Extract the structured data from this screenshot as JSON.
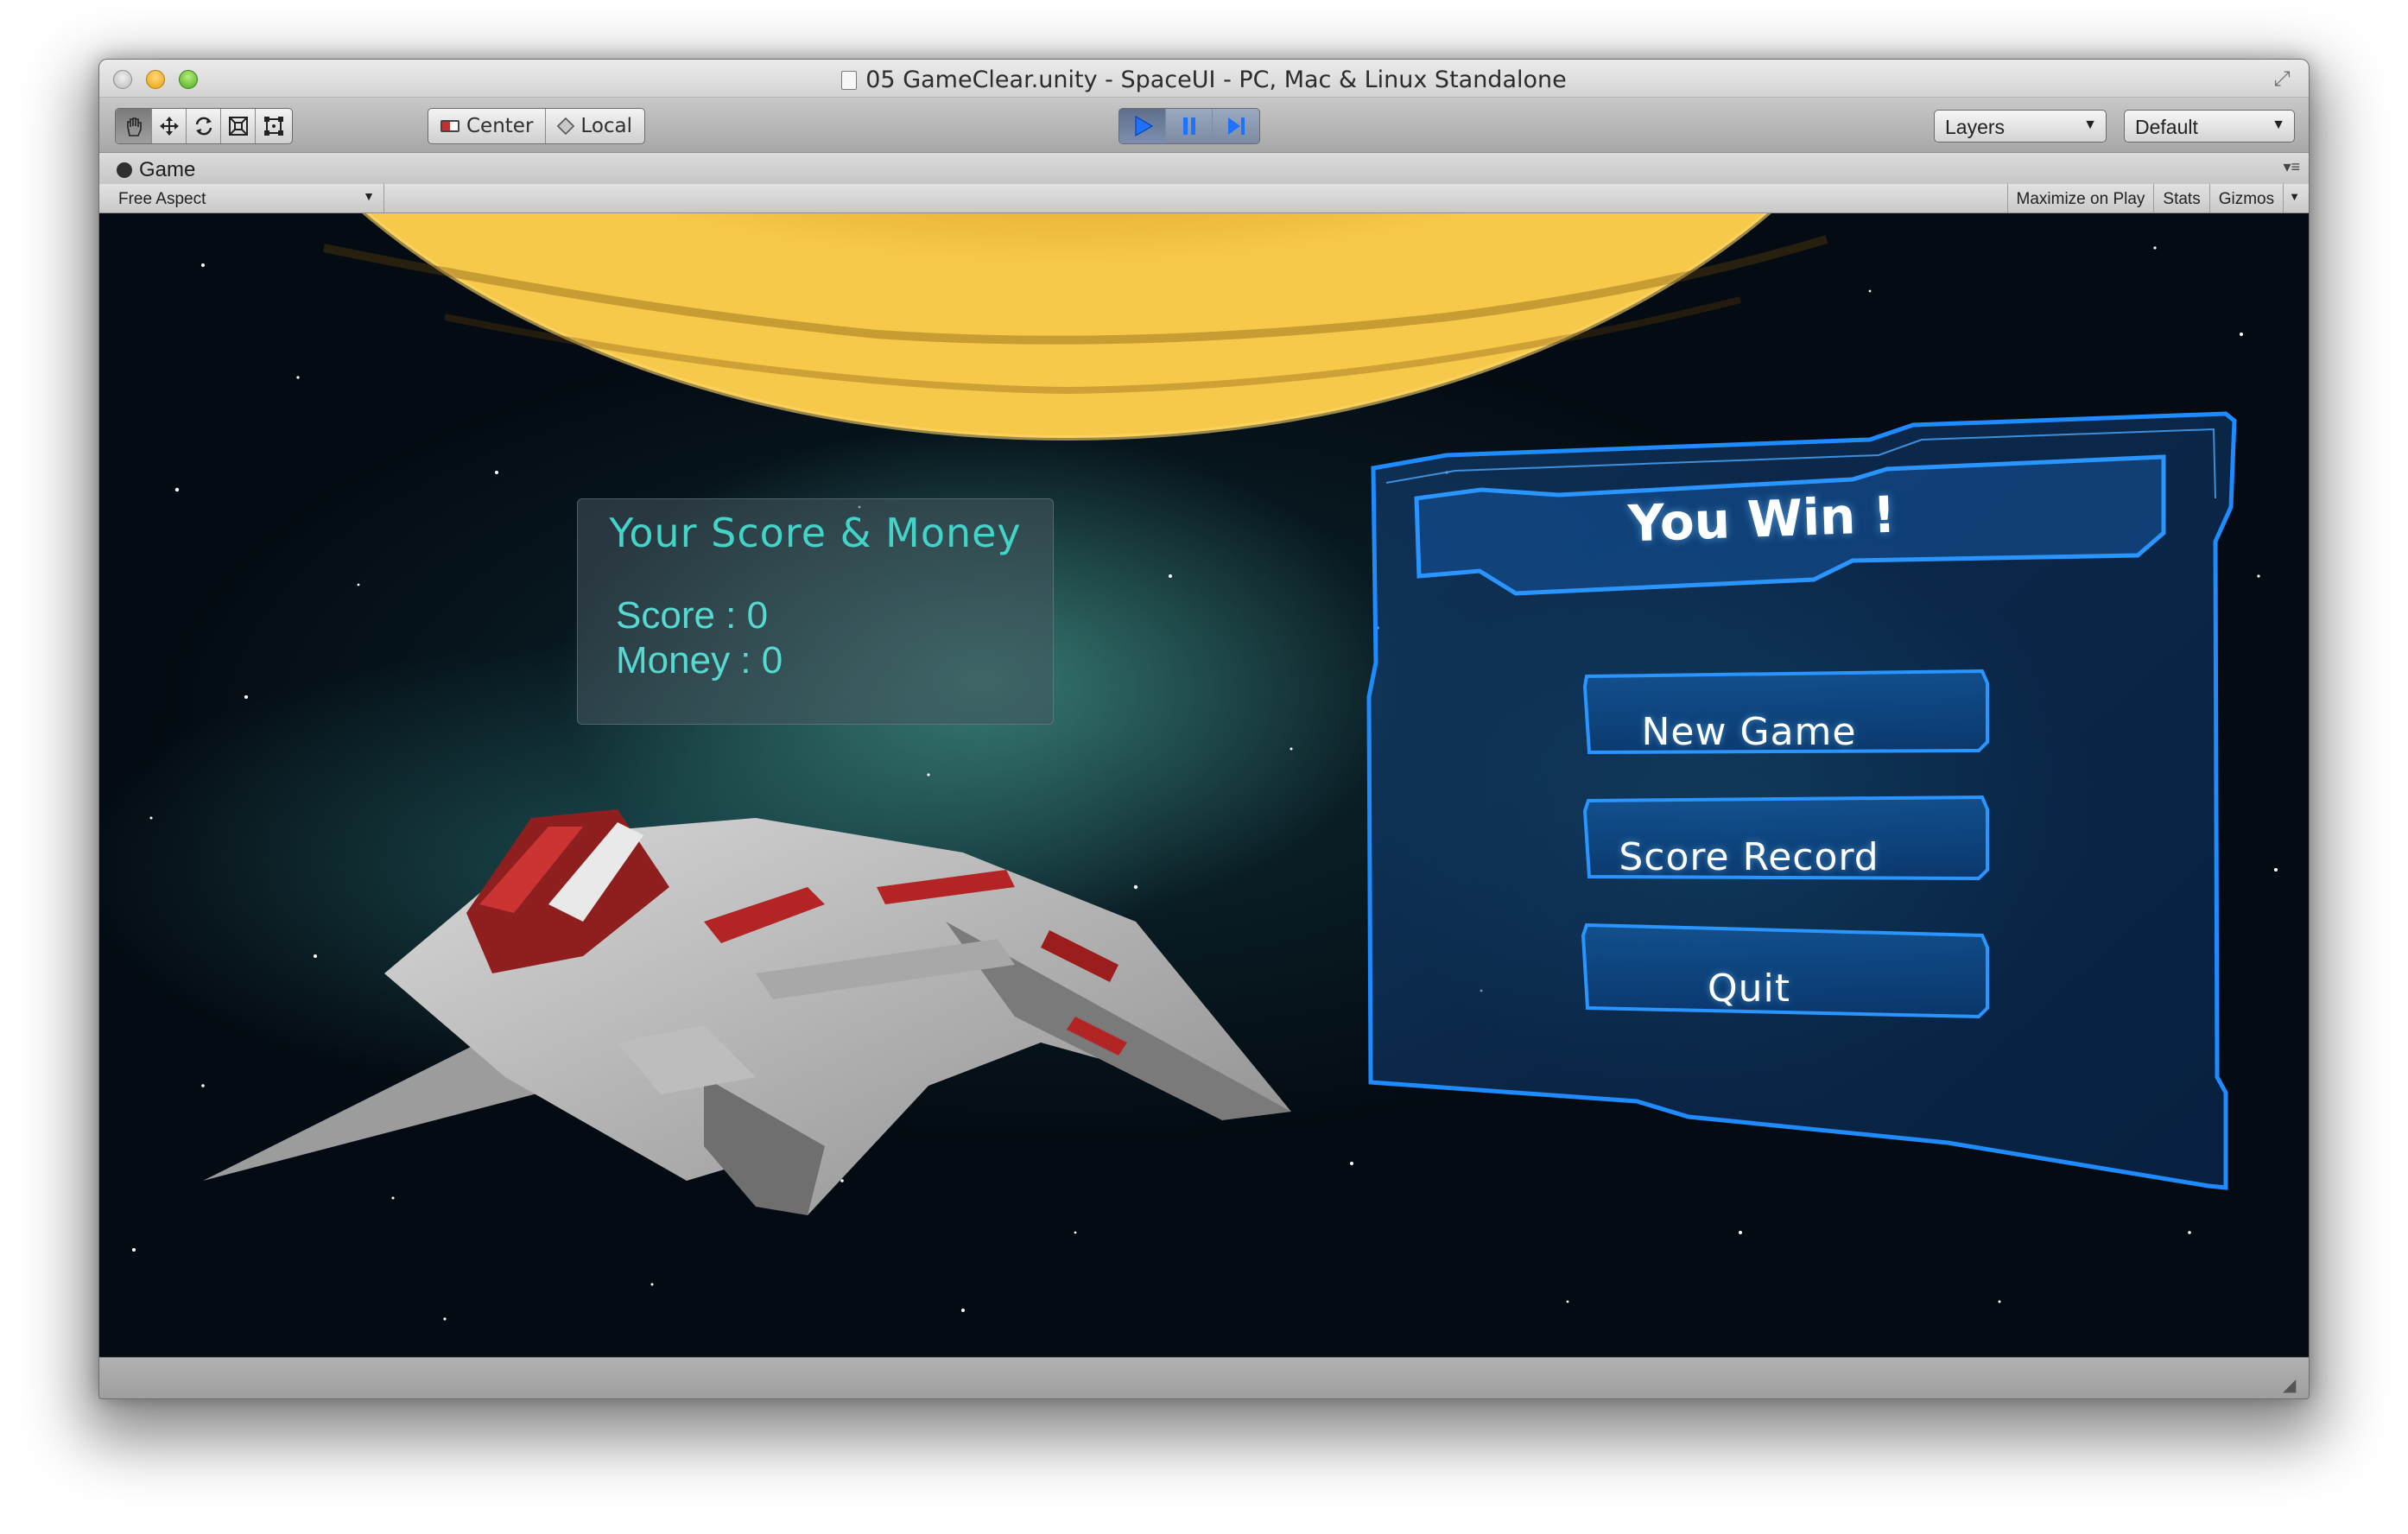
{
  "window": {
    "title": "05 GameClear.unity - SpaceUI - PC, Mac & Linux Standalone"
  },
  "toolbar": {
    "tools": [
      "hand-icon",
      "move-icon",
      "rotate-icon",
      "scale-icon",
      "rect-icon"
    ],
    "pivot_label": "Center",
    "space_label": "Local",
    "play_controls": [
      "play-icon",
      "pause-icon",
      "step-icon"
    ],
    "layers_label": "Layers",
    "layout_label": "Default"
  },
  "game_tab": {
    "label": "Game",
    "aspect_label": "Free Aspect",
    "maximize_label": "Maximize on Play",
    "stats_label": "Stats",
    "gizmos_label": "Gizmos"
  },
  "score_panel": {
    "title": "Your Score & Money",
    "score_text": "Score : 0",
    "money_text": "Money : 0"
  },
  "win_panel": {
    "title": "You Win !",
    "buttons": [
      "New Game",
      "Score Record",
      "Quit"
    ]
  },
  "colors": {
    "panel_accent": "#1e8bff",
    "score_text": "#42d4c8",
    "planet": "#c88a1c"
  }
}
